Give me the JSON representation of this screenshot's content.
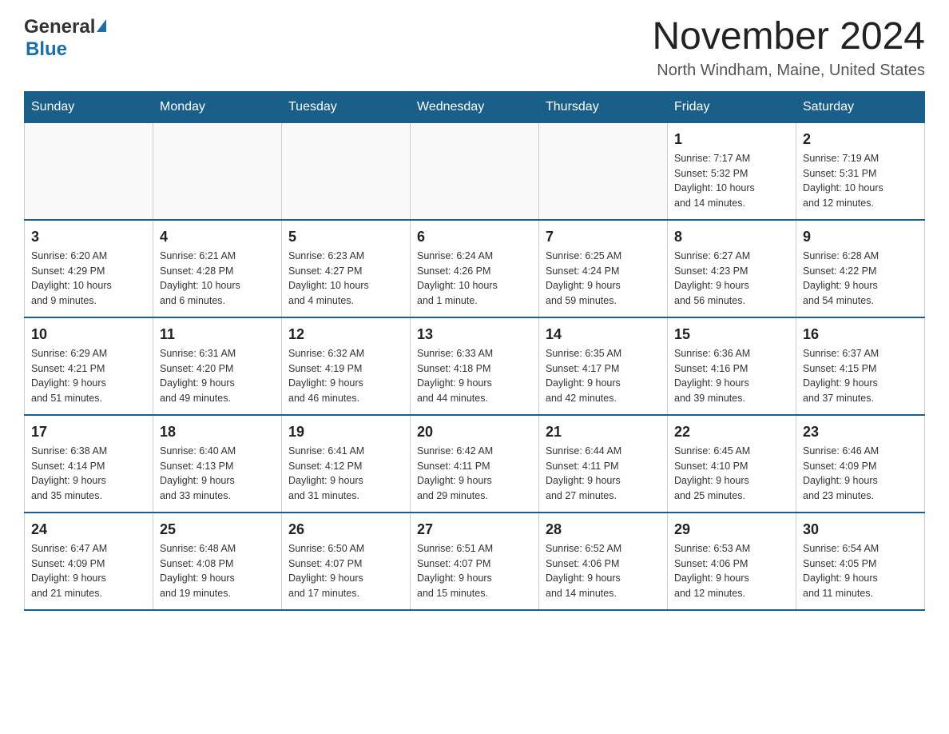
{
  "logo": {
    "general": "General",
    "blue": "Blue",
    "arrow": "▶"
  },
  "title": "November 2024",
  "subtitle": "North Windham, Maine, United States",
  "weekdays": [
    "Sunday",
    "Monday",
    "Tuesday",
    "Wednesday",
    "Thursday",
    "Friday",
    "Saturday"
  ],
  "weeks": [
    [
      {
        "day": "",
        "info": ""
      },
      {
        "day": "",
        "info": ""
      },
      {
        "day": "",
        "info": ""
      },
      {
        "day": "",
        "info": ""
      },
      {
        "day": "",
        "info": ""
      },
      {
        "day": "1",
        "info": "Sunrise: 7:17 AM\nSunset: 5:32 PM\nDaylight: 10 hours\nand 14 minutes."
      },
      {
        "day": "2",
        "info": "Sunrise: 7:19 AM\nSunset: 5:31 PM\nDaylight: 10 hours\nand 12 minutes."
      }
    ],
    [
      {
        "day": "3",
        "info": "Sunrise: 6:20 AM\nSunset: 4:29 PM\nDaylight: 10 hours\nand 9 minutes."
      },
      {
        "day": "4",
        "info": "Sunrise: 6:21 AM\nSunset: 4:28 PM\nDaylight: 10 hours\nand 6 minutes."
      },
      {
        "day": "5",
        "info": "Sunrise: 6:23 AM\nSunset: 4:27 PM\nDaylight: 10 hours\nand 4 minutes."
      },
      {
        "day": "6",
        "info": "Sunrise: 6:24 AM\nSunset: 4:26 PM\nDaylight: 10 hours\nand 1 minute."
      },
      {
        "day": "7",
        "info": "Sunrise: 6:25 AM\nSunset: 4:24 PM\nDaylight: 9 hours\nand 59 minutes."
      },
      {
        "day": "8",
        "info": "Sunrise: 6:27 AM\nSunset: 4:23 PM\nDaylight: 9 hours\nand 56 minutes."
      },
      {
        "day": "9",
        "info": "Sunrise: 6:28 AM\nSunset: 4:22 PM\nDaylight: 9 hours\nand 54 minutes."
      }
    ],
    [
      {
        "day": "10",
        "info": "Sunrise: 6:29 AM\nSunset: 4:21 PM\nDaylight: 9 hours\nand 51 minutes."
      },
      {
        "day": "11",
        "info": "Sunrise: 6:31 AM\nSunset: 4:20 PM\nDaylight: 9 hours\nand 49 minutes."
      },
      {
        "day": "12",
        "info": "Sunrise: 6:32 AM\nSunset: 4:19 PM\nDaylight: 9 hours\nand 46 minutes."
      },
      {
        "day": "13",
        "info": "Sunrise: 6:33 AM\nSunset: 4:18 PM\nDaylight: 9 hours\nand 44 minutes."
      },
      {
        "day": "14",
        "info": "Sunrise: 6:35 AM\nSunset: 4:17 PM\nDaylight: 9 hours\nand 42 minutes."
      },
      {
        "day": "15",
        "info": "Sunrise: 6:36 AM\nSunset: 4:16 PM\nDaylight: 9 hours\nand 39 minutes."
      },
      {
        "day": "16",
        "info": "Sunrise: 6:37 AM\nSunset: 4:15 PM\nDaylight: 9 hours\nand 37 minutes."
      }
    ],
    [
      {
        "day": "17",
        "info": "Sunrise: 6:38 AM\nSunset: 4:14 PM\nDaylight: 9 hours\nand 35 minutes."
      },
      {
        "day": "18",
        "info": "Sunrise: 6:40 AM\nSunset: 4:13 PM\nDaylight: 9 hours\nand 33 minutes."
      },
      {
        "day": "19",
        "info": "Sunrise: 6:41 AM\nSunset: 4:12 PM\nDaylight: 9 hours\nand 31 minutes."
      },
      {
        "day": "20",
        "info": "Sunrise: 6:42 AM\nSunset: 4:11 PM\nDaylight: 9 hours\nand 29 minutes."
      },
      {
        "day": "21",
        "info": "Sunrise: 6:44 AM\nSunset: 4:11 PM\nDaylight: 9 hours\nand 27 minutes."
      },
      {
        "day": "22",
        "info": "Sunrise: 6:45 AM\nSunset: 4:10 PM\nDaylight: 9 hours\nand 25 minutes."
      },
      {
        "day": "23",
        "info": "Sunrise: 6:46 AM\nSunset: 4:09 PM\nDaylight: 9 hours\nand 23 minutes."
      }
    ],
    [
      {
        "day": "24",
        "info": "Sunrise: 6:47 AM\nSunset: 4:09 PM\nDaylight: 9 hours\nand 21 minutes."
      },
      {
        "day": "25",
        "info": "Sunrise: 6:48 AM\nSunset: 4:08 PM\nDaylight: 9 hours\nand 19 minutes."
      },
      {
        "day": "26",
        "info": "Sunrise: 6:50 AM\nSunset: 4:07 PM\nDaylight: 9 hours\nand 17 minutes."
      },
      {
        "day": "27",
        "info": "Sunrise: 6:51 AM\nSunset: 4:07 PM\nDaylight: 9 hours\nand 15 minutes."
      },
      {
        "day": "28",
        "info": "Sunrise: 6:52 AM\nSunset: 4:06 PM\nDaylight: 9 hours\nand 14 minutes."
      },
      {
        "day": "29",
        "info": "Sunrise: 6:53 AM\nSunset: 4:06 PM\nDaylight: 9 hours\nand 12 minutes."
      },
      {
        "day": "30",
        "info": "Sunrise: 6:54 AM\nSunset: 4:05 PM\nDaylight: 9 hours\nand 11 minutes."
      }
    ]
  ]
}
